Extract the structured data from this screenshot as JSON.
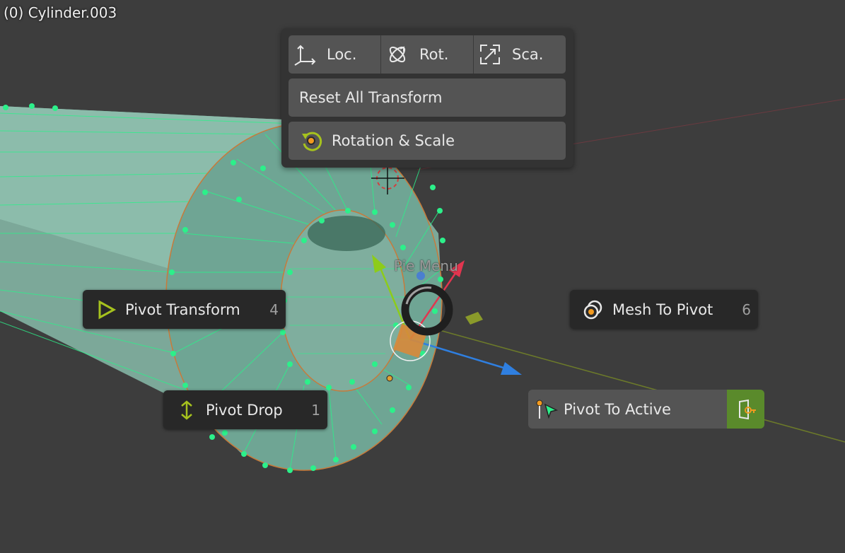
{
  "viewport": {
    "object_label": "(0) Cylinder.003",
    "pie_title": "Pie Menu"
  },
  "top_panel": {
    "loc_label": "Loc.",
    "rot_label": "Rot.",
    "sca_label": "Sca.",
    "reset_all_label": "Reset All Transform",
    "rotation_scale_label": "Rotation & Scale"
  },
  "pie": {
    "pivot_transform": {
      "label": "Pivot Transform",
      "key": "4"
    },
    "mesh_to_pivot": {
      "label": "Mesh To Pivot",
      "key": "6"
    },
    "pivot_drop": {
      "label": "Pivot Drop",
      "key": "1"
    },
    "pivot_to_active": {
      "label": "Pivot To Active"
    }
  },
  "colors": {
    "background": "#3d3d3d",
    "mesh_fill": "#7fb8a6",
    "vertex": "#2cf08a",
    "accent_green": "#a6c21e",
    "active_button": "#5a8a2b",
    "x_axis": "#e2354f",
    "y_axis": "#8dcc1a",
    "z_axis": "#2f7fe0"
  },
  "icons": [
    "loc-axes-icon",
    "rot-icon",
    "scale-icon",
    "rotation-scale-icon",
    "pivot-transform-icon",
    "mesh-to-pivot-icon",
    "pivot-drop-icon",
    "pivot-to-active-icon",
    "exit-icon"
  ]
}
